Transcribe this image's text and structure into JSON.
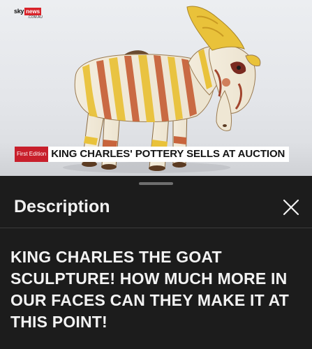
{
  "video": {
    "logo": {
      "brand": "sky",
      "news": "news",
      "domain": ".COM.AU"
    },
    "lower_third": {
      "label": "First Edition",
      "headline": "KING CHARLES' POTTERY SELLS AT AUCTION"
    }
  },
  "description_panel": {
    "title": "Description",
    "body": "KING CHARLES THE GOAT SCULPTURE! HOW MUCH MORE IN OUR FACES CAN THEY MAKE IT AT THIS POINT!",
    "close_icon": "close-x-icon"
  },
  "colors": {
    "news_red": "#d8232a",
    "sheet_background": "#1c1c1c",
    "text_primary": "#f1f1f1",
    "goat_stripe_yellow": "#e9c23a",
    "goat_stripe_red": "#c8643c"
  }
}
